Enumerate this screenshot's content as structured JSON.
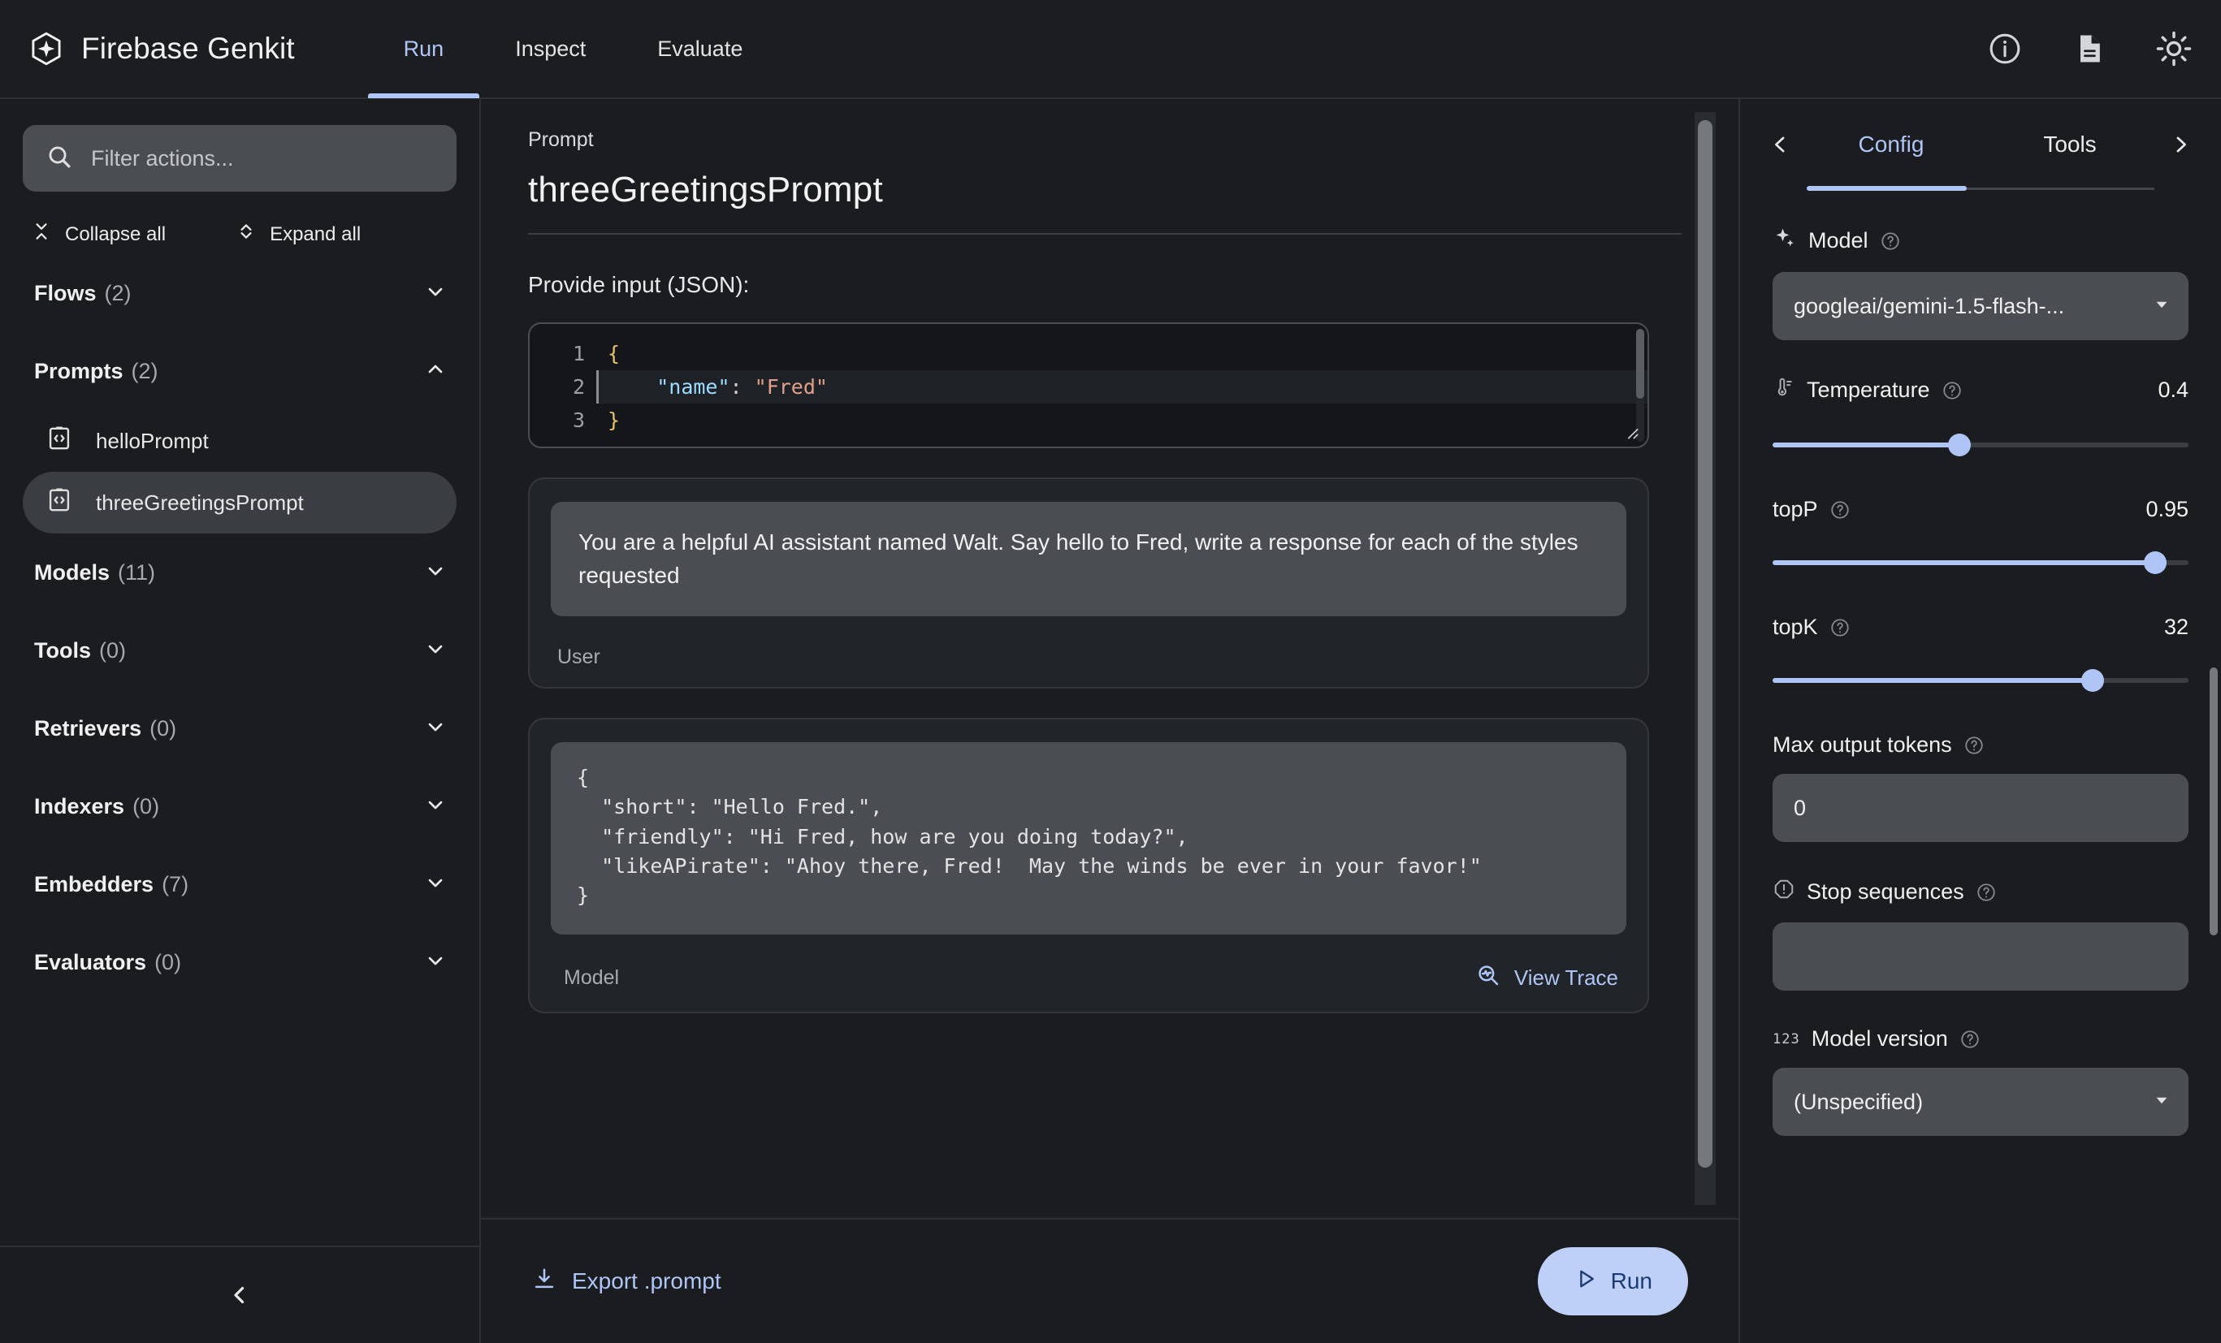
{
  "app": {
    "brand": "Firebase Genkit",
    "tabs": [
      {
        "label": "Run",
        "active": true
      },
      {
        "label": "Inspect",
        "active": false
      },
      {
        "label": "Evaluate",
        "active": false
      }
    ],
    "actions": [
      {
        "icon": "info-icon"
      },
      {
        "icon": "document-icon"
      },
      {
        "icon": "brightness-icon"
      }
    ]
  },
  "sidebar": {
    "search": {
      "value": "",
      "placeholder": "Filter actions..."
    },
    "collapse_all": "Collapse all",
    "expand_all": "Expand all",
    "sections": [
      {
        "title": "Flows",
        "count": "(2)",
        "expanded": false
      },
      {
        "title": "Prompts",
        "count": "(2)",
        "expanded": true
      },
      {
        "title": "Models",
        "count": "(11)",
        "expanded": false
      },
      {
        "title": "Tools",
        "count": "(0)",
        "expanded": false
      },
      {
        "title": "Retrievers",
        "count": "(0)",
        "expanded": false
      },
      {
        "title": "Indexers",
        "count": "(0)",
        "expanded": false
      },
      {
        "title": "Embedders",
        "count": "(7)",
        "expanded": false
      },
      {
        "title": "Evaluators",
        "count": "(0)",
        "expanded": false
      }
    ],
    "prompts": [
      {
        "label": "helloPrompt",
        "selected": false
      },
      {
        "label": "threeGreetingsPrompt",
        "selected": true
      }
    ]
  },
  "main": {
    "kicker": "Prompt",
    "title": "threeGreetingsPrompt",
    "input_label": "Provide input (JSON):",
    "input_editor": {
      "lines": [
        {
          "number": "1",
          "brace": "{"
        },
        {
          "number": "2",
          "key": "\"name\"",
          "colon": ": ",
          "value": "\"Fred\""
        },
        {
          "number": "3",
          "brace": "}"
        }
      ]
    },
    "system_message": "You are a helpful AI assistant named Walt. Say hello to Fred, write a response for each of the styles requested",
    "user_role_label": "User",
    "model_response": "{\n  \"short\": \"Hello Fred.\",\n  \"friendly\": \"Hi Fred, how are you doing today?\",\n  \"likeAPirate\": \"Ahoy there, Fred!  May the winds be ever in your favor!\"\n}",
    "model_role_label": "Model",
    "view_trace": "View Trace",
    "export_button": "Export .prompt",
    "run_button": "Run"
  },
  "config": {
    "tabs": [
      {
        "label": "Config",
        "active": true
      },
      {
        "label": "Tools",
        "active": false
      }
    ],
    "model": {
      "label": "Model",
      "value": "googleai/gemini-1.5-flash-..."
    },
    "temperature": {
      "label": "Temperature",
      "value": "0.4",
      "percent": 45
    },
    "topP": {
      "label": "topP",
      "value": "0.95",
      "percent": 92
    },
    "topK": {
      "label": "topK",
      "value": "32",
      "percent": 77
    },
    "max_output_tokens": {
      "label": "Max output tokens",
      "value": "0"
    },
    "stop_sequences": {
      "label": "Stop sequences",
      "value": ""
    },
    "model_version": {
      "label": "Model version",
      "value": "(Unspecified)",
      "icon_text": "123"
    }
  },
  "colors": {
    "accent": "#aec5f5",
    "background": "#1a1c1f",
    "surface": "#4a4d51",
    "run_button_bg": "#bed0f8"
  }
}
